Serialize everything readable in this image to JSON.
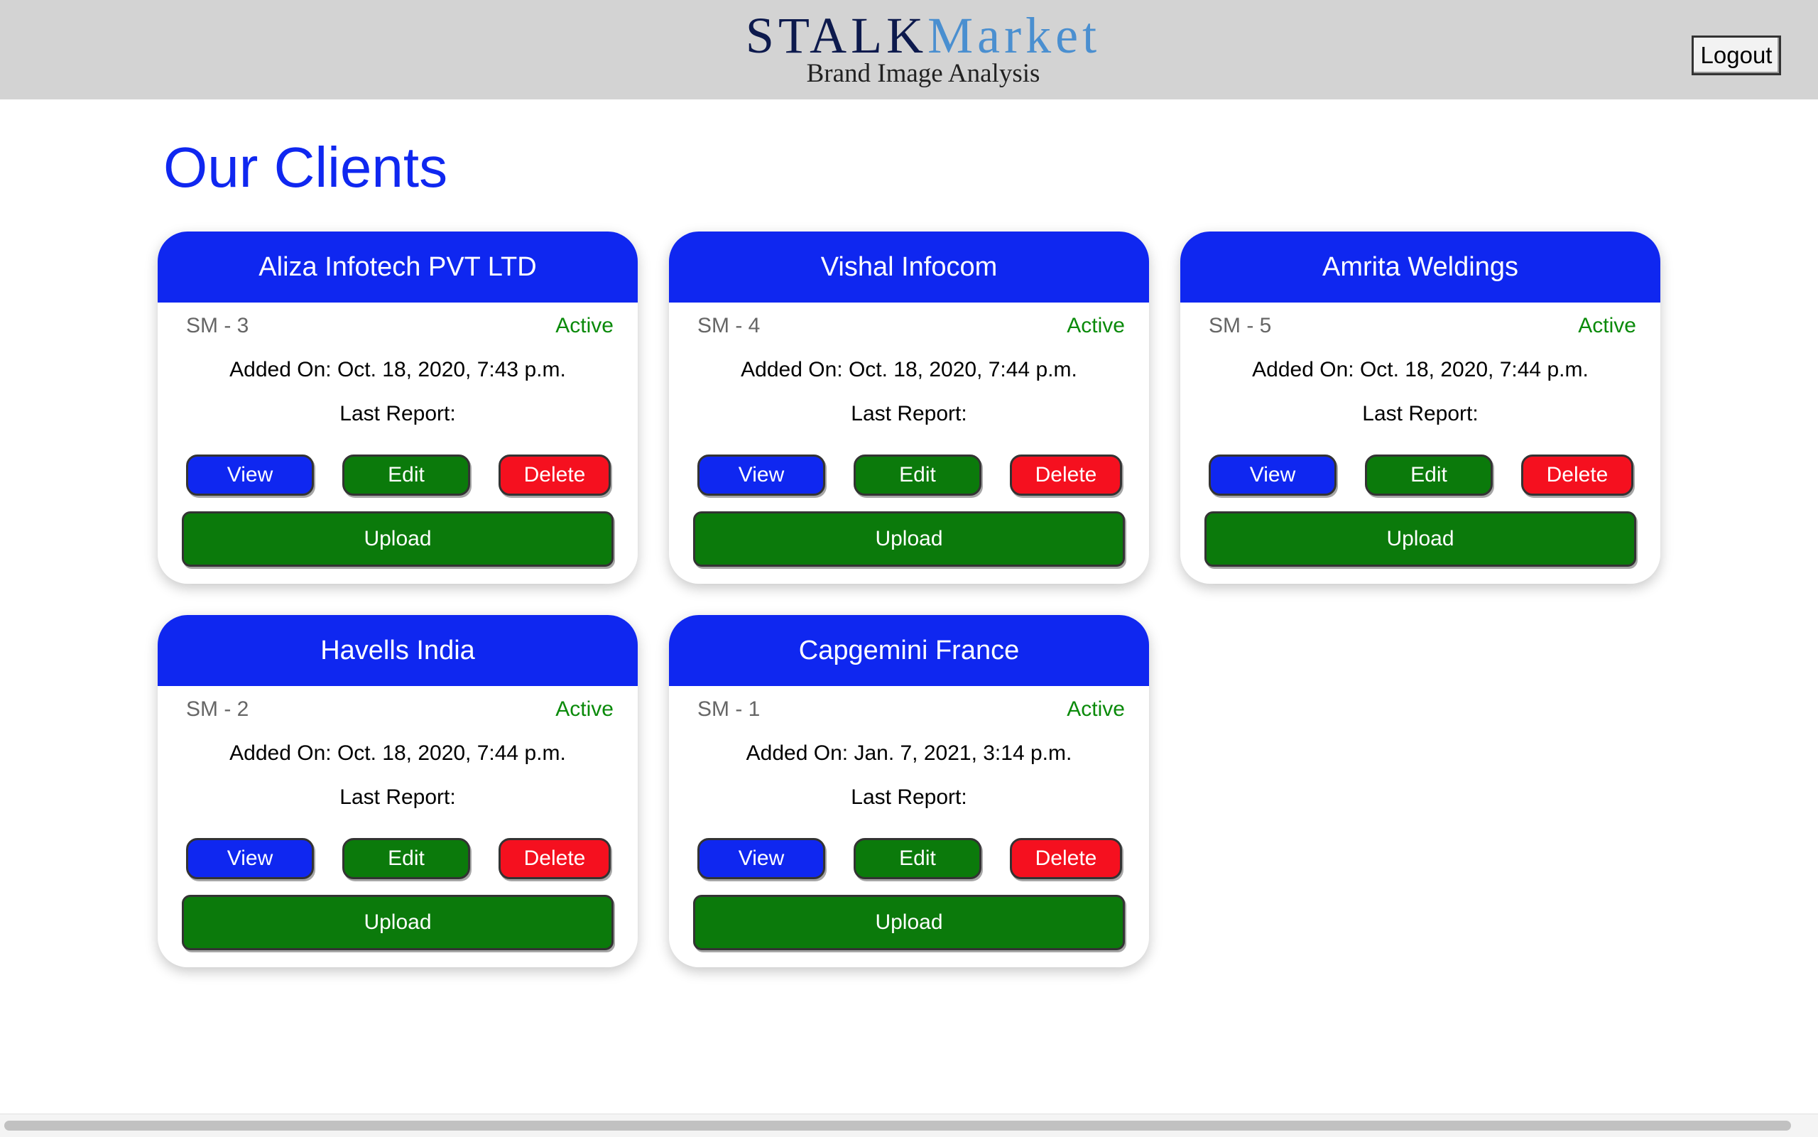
{
  "header": {
    "brand_primary": "STALK",
    "brand_secondary": "Market",
    "tagline": "Brand Image Analysis",
    "logout_label": "Logout"
  },
  "page_title": "Our Clients",
  "colors": {
    "primary_blue": "#0f27f0",
    "success_green": "#0b7a0b",
    "danger_red": "#f5101f",
    "status_green": "#0a8a0a",
    "header_gray": "#d3d3d3"
  },
  "labels": {
    "view": "View",
    "edit": "Edit",
    "delete": "Delete",
    "upload": "Upload",
    "last_report": "Last Report:"
  },
  "clients": [
    {
      "name": "Aliza Infotech PVT LTD",
      "code": "SM - 3",
      "status": "Active",
      "added_on": "Added On: Oct. 18, 2020, 7:43 p.m."
    },
    {
      "name": "Vishal Infocom",
      "code": "SM - 4",
      "status": "Active",
      "added_on": "Added On: Oct. 18, 2020, 7:44 p.m."
    },
    {
      "name": "Amrita Weldings",
      "code": "SM - 5",
      "status": "Active",
      "added_on": "Added On: Oct. 18, 2020, 7:44 p.m."
    },
    {
      "name": "Havells India",
      "code": "SM - 2",
      "status": "Active",
      "added_on": "Added On: Oct. 18, 2020, 7:44 p.m."
    },
    {
      "name": "Capgemini France",
      "code": "SM - 1",
      "status": "Active",
      "added_on": "Added On: Jan. 7, 2021, 3:14 p.m."
    }
  ]
}
